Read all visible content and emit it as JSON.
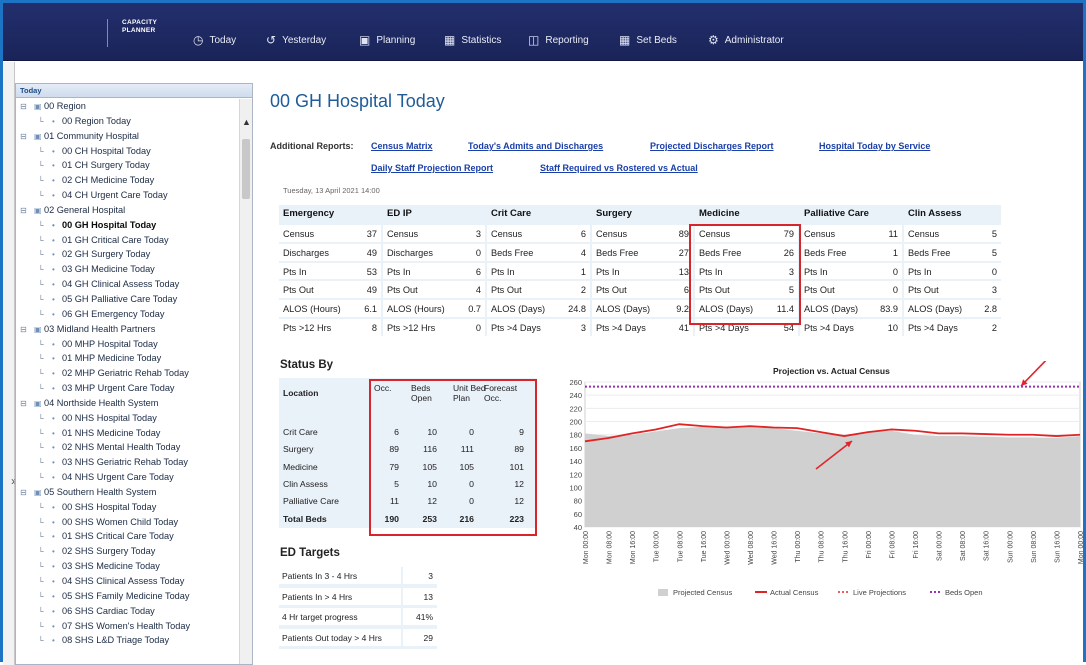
{
  "nav": {
    "brand_line1": "CAPACITY",
    "brand_line2": "PLANNER",
    "items": [
      {
        "label": "Today",
        "icon": "clock-icon"
      },
      {
        "label": "Yesterday",
        "icon": "history-icon"
      },
      {
        "label": "Planning",
        "icon": "calendar-icon"
      },
      {
        "label": "Statistics",
        "icon": "statistics-icon"
      },
      {
        "label": "Reporting",
        "icon": "report-icon"
      },
      {
        "label": "Set Beds",
        "icon": "bed-icon"
      },
      {
        "label": "Administrator",
        "icon": "gears-icon"
      }
    ]
  },
  "tree": {
    "header": "Today",
    "items": [
      {
        "label": "00 Region",
        "level": 0
      },
      {
        "label": "00 Region Today",
        "level": 1
      },
      {
        "label": "01 Community Hospital",
        "level": 0
      },
      {
        "label": "00 CH Hospital Today",
        "level": 1
      },
      {
        "label": "01 CH Surgery Today",
        "level": 1
      },
      {
        "label": "02 CH Medicine Today",
        "level": 1
      },
      {
        "label": "04 CH Urgent Care Today",
        "level": 1
      },
      {
        "label": "02 General Hospital",
        "level": 0
      },
      {
        "label": "00 GH Hospital Today",
        "level": 1,
        "selected": true
      },
      {
        "label": "01 GH Critical Care Today",
        "level": 1
      },
      {
        "label": "02 GH Surgery Today",
        "level": 1
      },
      {
        "label": "03 GH Medicine Today",
        "level": 1
      },
      {
        "label": "04 GH Clinical Assess Today",
        "level": 1
      },
      {
        "label": "05 GH Palliative Care Today",
        "level": 1
      },
      {
        "label": "06 GH Emergency Today",
        "level": 1
      },
      {
        "label": "03 Midland Health Partners",
        "level": 0
      },
      {
        "label": "00 MHP Hospital Today",
        "level": 1
      },
      {
        "label": "01 MHP Medicine Today",
        "level": 1
      },
      {
        "label": "02 MHP Geriatric Rehab Today",
        "level": 1
      },
      {
        "label": "03 MHP Urgent Care Today",
        "level": 1
      },
      {
        "label": "04 Northside Health System",
        "level": 0
      },
      {
        "label": "00 NHS Hospital Today",
        "level": 1
      },
      {
        "label": "01 NHS Medicine Today",
        "level": 1
      },
      {
        "label": "02 NHS Mental Health Today",
        "level": 1
      },
      {
        "label": "03 NHS Geriatric Rehab Today",
        "level": 1
      },
      {
        "label": "04 NHS Urgent Care Today",
        "level": 1
      },
      {
        "label": "05 Southern Health System",
        "level": 0
      },
      {
        "label": "00 SHS Hospital Today",
        "level": 1
      },
      {
        "label": "00 SHS Women Child Today",
        "level": 1
      },
      {
        "label": "01 SHS Critical Care Today",
        "level": 1
      },
      {
        "label": "02 SHS Surgery Today",
        "level": 1
      },
      {
        "label": "03 SHS Medicine Today",
        "level": 1
      },
      {
        "label": "04 SHS Clinical Assess Today",
        "level": 1
      },
      {
        "label": "05 SHS Family Medicine Today",
        "level": 1
      },
      {
        "label": "06 SHS Cardiac Today",
        "level": 1
      },
      {
        "label": "07 SHS Women's Health Today",
        "level": 1
      },
      {
        "label": "08 SHS L&D Triage Today",
        "level": 1
      }
    ]
  },
  "page": {
    "title": "00 GH Hospital Today",
    "additional_reports_label": "Additional Reports:",
    "reports": [
      "Census Matrix",
      "Today's Admits and Discharges",
      "Projected Discharges Report",
      "Hospital Today by Service",
      "Daily Staff Projection Report",
      "Staff Required vs Rostered vs Actual"
    ],
    "date": "Tuesday, 13 April 2021 14:00"
  },
  "metrics": [
    {
      "name": "Emergency",
      "rows": [
        [
          "Census",
          "37"
        ],
        [
          "Discharges",
          "49"
        ],
        [
          "Pts In",
          "53"
        ],
        [
          "Pts Out",
          "49"
        ],
        [
          "ALOS (Hours)",
          "6.1"
        ],
        [
          "Pts >12 Hrs",
          "8"
        ]
      ]
    },
    {
      "name": "ED IP",
      "rows": [
        [
          "Census",
          "3"
        ],
        [
          "Discharges",
          "0"
        ],
        [
          "Pts In",
          "6"
        ],
        [
          "Pts Out",
          "4"
        ],
        [
          "ALOS (Hours)",
          "0.7"
        ],
        [
          "Pts >12 Hrs",
          "0"
        ]
      ]
    },
    {
      "name": "Crit Care",
      "rows": [
        [
          "Census",
          "6"
        ],
        [
          "Beds Free",
          "4"
        ],
        [
          "Pts In",
          "1"
        ],
        [
          "Pts Out",
          "2"
        ],
        [
          "ALOS (Days)",
          "24.8"
        ],
        [
          "Pts >4 Days",
          "3"
        ]
      ]
    },
    {
      "name": "Surgery",
      "rows": [
        [
          "Census",
          "89"
        ],
        [
          "Beds Free",
          "27"
        ],
        [
          "Pts In",
          "13"
        ],
        [
          "Pts Out",
          "6"
        ],
        [
          "ALOS (Days)",
          "9.2"
        ],
        [
          "Pts >4 Days",
          "41"
        ]
      ]
    },
    {
      "name": "Medicine",
      "rows": [
        [
          "Census",
          "79"
        ],
        [
          "Beds Free",
          "26"
        ],
        [
          "Pts In",
          "3"
        ],
        [
          "Pts Out",
          "5"
        ],
        [
          "ALOS (Days)",
          "11.4"
        ],
        [
          "Pts >4 Days",
          "54"
        ]
      ]
    },
    {
      "name": "Palliative Care",
      "rows": [
        [
          "Census",
          "11"
        ],
        [
          "Beds Free",
          "1"
        ],
        [
          "Pts In",
          "0"
        ],
        [
          "Pts Out",
          "0"
        ],
        [
          "ALOS (Days)",
          "83.9"
        ],
        [
          "Pts >4 Days",
          "10"
        ]
      ]
    },
    {
      "name": "Clin Assess",
      "rows": [
        [
          "Census",
          "5"
        ],
        [
          "Beds Free",
          "5"
        ],
        [
          "Pts In",
          "0"
        ],
        [
          "Pts Out",
          "3"
        ],
        [
          "ALOS (Days)",
          "2.8"
        ],
        [
          "Pts >4 Days",
          "2"
        ]
      ]
    }
  ],
  "status_by": {
    "title": "Status By",
    "headers": [
      "Location",
      "Occ.",
      "Beds Open",
      "Unit Bed Plan",
      "Forecast Occ."
    ],
    "rows": [
      [
        "Crit Care",
        "6",
        "10",
        "0",
        "9"
      ],
      [
        "Surgery",
        "89",
        "116",
        "111",
        "89"
      ],
      [
        "Medicine",
        "79",
        "105",
        "105",
        "101"
      ],
      [
        "Clin Assess",
        "5",
        "10",
        "0",
        "12"
      ],
      [
        "Palliative Care",
        "11",
        "12",
        "0",
        "12"
      ],
      [
        "Total Beds",
        "190",
        "253",
        "216",
        "223"
      ]
    ]
  },
  "ed_targets": {
    "title": "ED Targets",
    "rows": [
      [
        "Patients In 3 - 4 Hrs",
        "3"
      ],
      [
        "Patients In > 4 Hrs",
        "13"
      ],
      [
        "4 Hr target progress",
        "41%"
      ],
      [
        "Patients Out today > 4 Hrs",
        "29"
      ]
    ]
  },
  "chart_data": {
    "type": "area",
    "title": "Projection vs. Actual Census",
    "ylim": [
      40,
      260
    ],
    "yticks": [
      40,
      60,
      80,
      100,
      120,
      140,
      160,
      180,
      200,
      220,
      240,
      260
    ],
    "x": [
      "Mon 00:00",
      "Mon 08:00",
      "Mon 16:00",
      "Tue 00:00",
      "Tue 08:00",
      "Tue 16:00",
      "Wed 00:00",
      "Wed 08:00",
      "Wed 16:00",
      "Thu 00:00",
      "Thu 08:00",
      "Thu 16:00",
      "Fri 00:00",
      "Fri 08:00",
      "Fri 16:00",
      "Sat 00:00",
      "Sat 08:00",
      "Sat 16:00",
      "Sun 00:00",
      "Sun 08:00",
      "Sun 16:00",
      "Mon 00:00"
    ],
    "series": [
      {
        "name": "Projected Census",
        "values": [
          182,
          178,
          180,
          185,
          190,
          192,
          192,
          192,
          190,
          186,
          182,
          180,
          184,
          186,
          180,
          178,
          178,
          177,
          176,
          176,
          175,
          178
        ],
        "color": "#d0d0d0"
      },
      {
        "name": "Actual Census",
        "values": [
          170,
          175,
          182,
          188,
          196,
          193,
          191,
          193,
          191,
          190,
          184,
          178,
          184,
          188,
          186,
          182,
          182,
          181,
          180,
          180,
          178,
          180
        ],
        "color": "#e02424"
      },
      {
        "name": "Live Projections",
        "values": [],
        "color": "#e86060"
      },
      {
        "name": "Beds Open",
        "values": [
          253,
          253,
          253,
          253,
          253,
          253,
          253,
          253,
          253,
          253,
          253,
          253,
          253,
          253,
          253,
          253,
          253,
          253,
          253,
          253,
          253,
          253
        ],
        "color": "#9a2fb0"
      }
    ],
    "legend_position": "bottom"
  },
  "colors": {
    "nav_bg": "#1f2a66",
    "accent_link": "#1a3fa8",
    "title": "#1f5c99",
    "highlight": "#d6262b"
  }
}
